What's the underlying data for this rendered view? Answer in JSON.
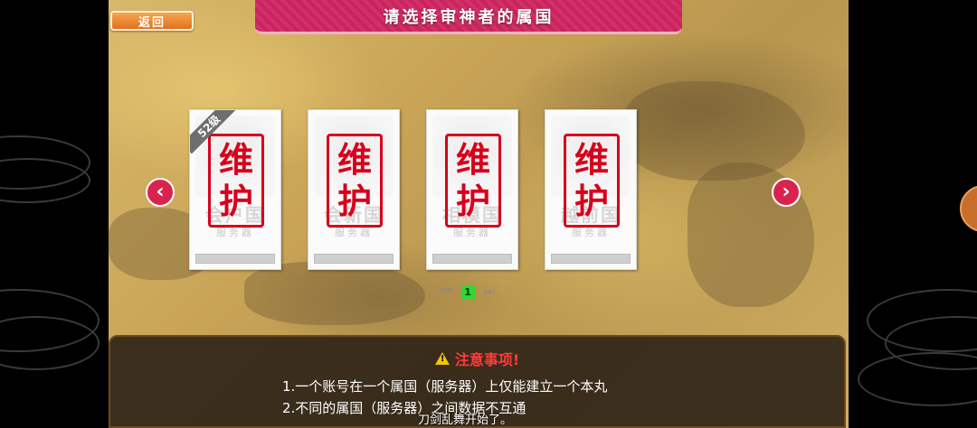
{
  "header": {
    "back_label": "返回",
    "title": "请选择审神者的属国"
  },
  "nav": {
    "prev_icon": "‹",
    "next_icon": "›"
  },
  "cards": [
    {
      "stamp_top": "维",
      "stamp_bottom": "护",
      "server_name": "会户国",
      "server_sub": "服务器",
      "level": "52",
      "level_unit": "级"
    },
    {
      "stamp_top": "维",
      "stamp_bottom": "护",
      "server_name": "会新国",
      "server_sub": "服务器"
    },
    {
      "stamp_top": "维",
      "stamp_bottom": "护",
      "server_name": "相模国",
      "server_sub": "服务器"
    },
    {
      "stamp_top": "维",
      "stamp_bottom": "护",
      "server_name": "越前国",
      "server_sub": "服务器"
    }
  ],
  "pager": {
    "first_icon": "⏮",
    "last_icon": "⏭",
    "current_page": "1"
  },
  "notice": {
    "title": "注意事项!",
    "lines": [
      "1.一个账号在一个属国（服务器）上仅能建立一个本丸",
      "2.不同的属国（服务器）之间数据不互通"
    ]
  },
  "toast": "刀剑乱舞开始了。",
  "colors": {
    "accent": "#d9234f",
    "stamp": "#d6001c",
    "notice_title": "#ff3a3a",
    "page_active": "#2fd82f"
  }
}
